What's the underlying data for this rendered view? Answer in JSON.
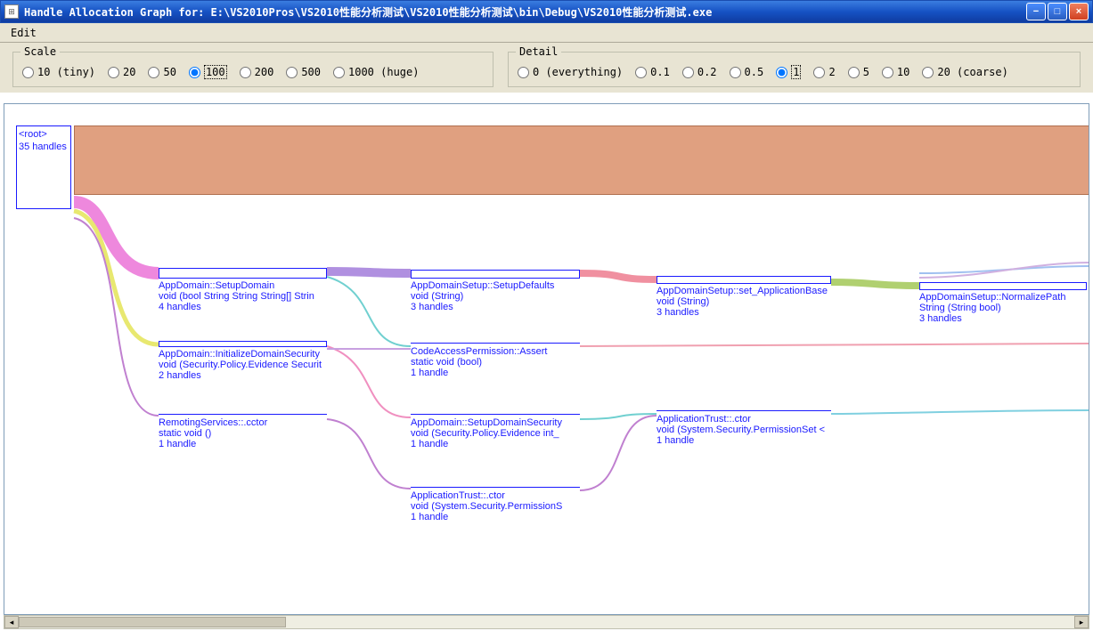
{
  "window": {
    "title": "Handle Allocation Graph for: E:\\VS2010Pros\\VS2010性能分析测试\\VS2010性能分析测试\\bin\\Debug\\VS2010性能分析测试.exe"
  },
  "menu": {
    "edit": "Edit"
  },
  "scale": {
    "legend": "Scale",
    "options": [
      "10 (tiny)",
      "20",
      "50",
      "100",
      "200",
      "500",
      "1000 (huge)"
    ],
    "selected": "100"
  },
  "detail": {
    "legend": "Detail",
    "options": [
      "0 (everything)",
      "0.1",
      "0.2",
      "0.5",
      "1",
      "2",
      "5",
      "10",
      "20 (coarse)"
    ],
    "selected": "1"
  },
  "nodes": {
    "root": {
      "l1": "<root>",
      "l2": "35 handles"
    },
    "n1": {
      "l1": "AppDomain::SetupDomain",
      "l2": "void (bool String String String[] Strin",
      "l3": "4 handles"
    },
    "n2": {
      "l1": "AppDomain::InitializeDomainSecurity",
      "l2": "void (Security.Policy.Evidence Securit",
      "l3": "2 handles"
    },
    "n3": {
      "l1": "RemotingServices::.cctor",
      "l2": "static void ()",
      "l3": "1 handle"
    },
    "n4": {
      "l1": "AppDomainSetup::SetupDefaults",
      "l2": "void (String)",
      "l3": "3 handles"
    },
    "n5": {
      "l1": "CodeAccessPermission::Assert",
      "l2": "static void (bool)",
      "l3": "1 handle"
    },
    "n6": {
      "l1": "AppDomain::SetupDomainSecurity",
      "l2": "void (Security.Policy.Evidence int_",
      "l3": "1 handle"
    },
    "n7": {
      "l1": "ApplicationTrust::.ctor",
      "l2": "void (System.Security.PermissionS",
      "l3": "1 handle"
    },
    "n8": {
      "l1": "AppDomainSetup::set_ApplicationBase",
      "l2": "void (String)",
      "l3": "3 handles"
    },
    "n9": {
      "l1": "ApplicationTrust::.ctor",
      "l2": "void (System.Security.PermissionSet <",
      "l3": "1 handle"
    },
    "n10": {
      "l1": "AppDomainSetup::NormalizePath",
      "l2": "String (String bool)",
      "l3": "3 handles"
    }
  }
}
